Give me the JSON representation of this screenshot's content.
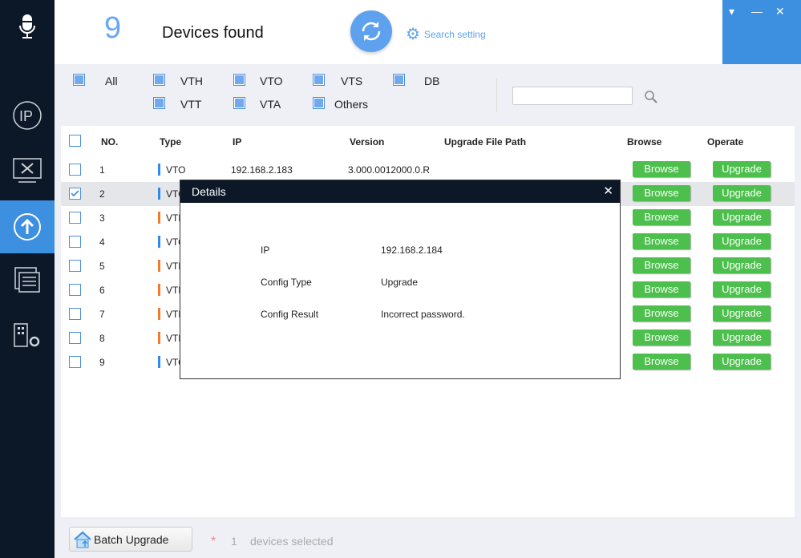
{
  "header": {
    "count": "9",
    "found_label": "Devices found",
    "search_setting": "Search setting"
  },
  "window": {
    "menu": "▾",
    "minimize": "—",
    "close": "✕"
  },
  "filters": {
    "all": "All",
    "vth": "VTH",
    "vto": "VTO",
    "vts": "VTS",
    "db": "DB",
    "vtt": "VTT",
    "vta": "VTA",
    "others": "Others",
    "search_value": ""
  },
  "table": {
    "headers": {
      "no": "NO.",
      "type": "Type",
      "ip": "IP",
      "version": "Version",
      "path": "Upgrade File Path",
      "browse": "Browse",
      "operate": "Operate"
    },
    "rows": [
      {
        "no": "1",
        "type": "VTO",
        "ip": "192.168.2.183",
        "version": "3.000.0012000.0.R",
        "checked": false
      },
      {
        "no": "2",
        "type": "VTO",
        "ip": "",
        "version": "",
        "checked": true
      },
      {
        "no": "3",
        "type": "VTH",
        "ip": "",
        "version": "",
        "checked": false
      },
      {
        "no": "4",
        "type": "VTO",
        "ip": "",
        "version": "",
        "checked": false
      },
      {
        "no": "5",
        "type": "VTH",
        "ip": "",
        "version": "",
        "checked": false
      },
      {
        "no": "6",
        "type": "VTH",
        "ip": "",
        "version": "",
        "checked": false
      },
      {
        "no": "7",
        "type": "VTH",
        "ip": "",
        "version": "",
        "checked": false
      },
      {
        "no": "8",
        "type": "VTH",
        "ip": "",
        "version": "",
        "checked": false
      },
      {
        "no": "9",
        "type": "VTO",
        "ip": "",
        "version": "",
        "checked": false
      }
    ],
    "browse_label": "Browse",
    "upgrade_label": "Upgrade"
  },
  "colors": {
    "VTO": "#2f8be6",
    "VTH": "#f07b2a",
    "accent": "#3d8fe0",
    "green": "#4cbf4c"
  },
  "dialog": {
    "title": "Details",
    "close": "✕",
    "ip_label": "IP",
    "ip_value": "192.168.2.184",
    "type_label": "Config Type",
    "type_value": "Upgrade",
    "result_label": "Config Result",
    "result_value": "Incorrect password."
  },
  "footer": {
    "batch_upgrade": "Batch Upgrade",
    "star": "*",
    "selected_count": "1",
    "selected_text": "devices selected"
  }
}
